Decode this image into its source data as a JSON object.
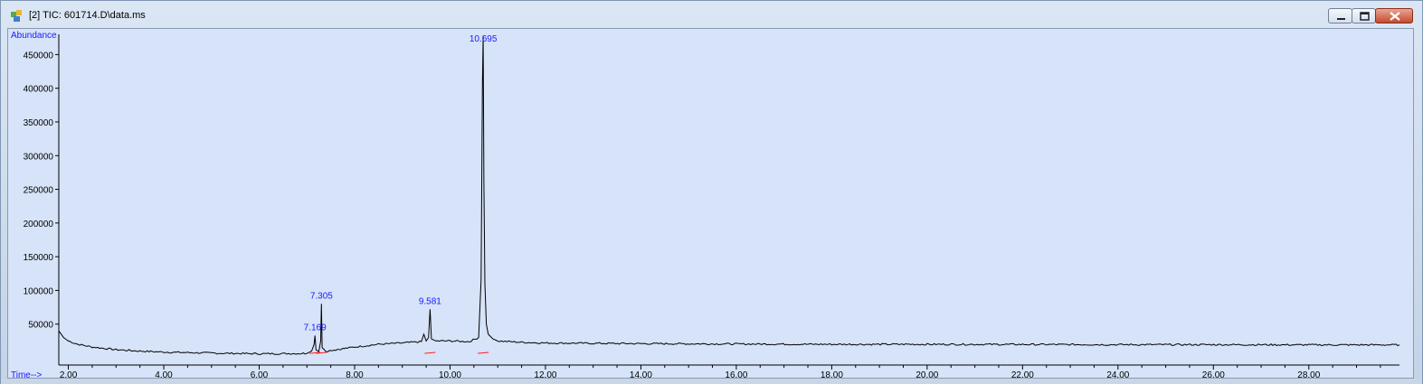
{
  "window": {
    "title": "[2] TIC: 601714.D\\data.ms",
    "icon": "chromatogram-app-icon",
    "controls": {
      "minimize": "minimize-icon",
      "maximize": "maximize-icon",
      "close": "close-icon"
    }
  },
  "chart_data": {
    "type": "line",
    "title": "",
    "ylabel": "Abundance",
    "xlabel": "Time-->",
    "x_ticks": [
      "2.00",
      "4.00",
      "6.00",
      "8.00",
      "10.00",
      "12.00",
      "14.00",
      "16.00",
      "18.00",
      "20.00",
      "22.00",
      "24.00",
      "26.00",
      "28.00"
    ],
    "y_ticks": [
      "50000",
      "100000",
      "150000",
      "200000",
      "250000",
      "300000",
      "350000",
      "400000",
      "450000"
    ],
    "xlim": [
      1.8,
      29.9
    ],
    "ylim": [
      0,
      480000
    ],
    "series": [
      {
        "x": [
          1.8,
          1.9,
          2.0,
          2.2,
          2.5,
          3.0,
          3.5,
          4.0,
          5.0,
          6.0,
          7.0,
          7.1,
          7.15,
          7.169,
          7.19,
          7.25,
          7.29,
          7.305,
          7.32,
          7.4,
          7.6,
          8.0,
          8.5,
          9.0,
          9.4,
          9.45,
          9.5,
          9.55,
          9.581,
          9.61,
          9.7,
          10.0,
          10.4,
          10.6,
          10.65,
          10.68,
          10.695,
          10.71,
          10.73,
          10.76,
          10.8,
          10.9,
          11.0,
          11.5,
          12.0,
          14.0,
          16.0,
          18.0,
          20.0,
          22.0,
          24.0,
          26.0,
          28.0,
          29.9
        ],
        "y": [
          40000,
          30000,
          25000,
          20000,
          16000,
          12000,
          10000,
          8500,
          7000,
          6000,
          6500,
          10000,
          20000,
          33000,
          12000,
          9000,
          25000,
          80000,
          15000,
          10000,
          12000,
          16000,
          20000,
          22000,
          24000,
          35000,
          25000,
          30000,
          72000,
          28000,
          25000,
          25000,
          24000,
          30000,
          115000,
          410000,
          478000,
          260000,
          110000,
          50000,
          35000,
          28000,
          25000,
          23000,
          22000,
          21000,
          20500,
          20000,
          20000,
          19800,
          19500,
          19500,
          19200,
          19200
        ]
      }
    ],
    "peak_labels": [
      {
        "x": 7.169,
        "y": 33000,
        "label": "7.169"
      },
      {
        "x": 7.305,
        "y": 80000,
        "label": "7.305"
      },
      {
        "x": 9.581,
        "y": 72000,
        "label": "9.581"
      },
      {
        "x": 10.695,
        "y": 478000,
        "label": "10.695"
      }
    ],
    "grid": false,
    "background": "#d6e3f8",
    "line_color": "#000000",
    "label_color": "#1a1aff",
    "baseline_color": "#ff2020"
  }
}
